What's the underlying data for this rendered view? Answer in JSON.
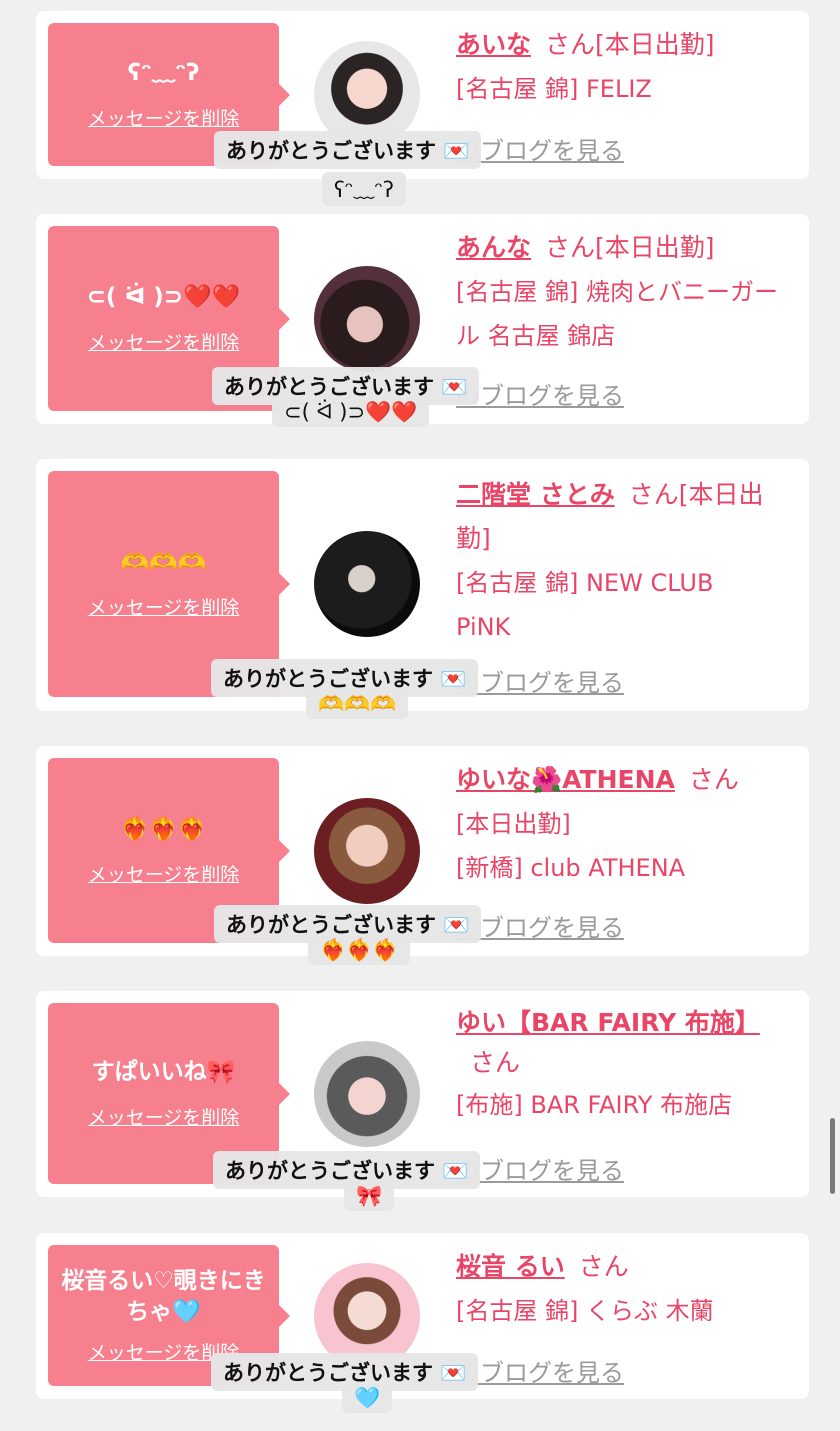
{
  "labels": {
    "delete": "メッセージを削除",
    "blog": "のブログを見る",
    "toast_title": "ありがとうございます",
    "mail_icon": "💌"
  },
  "cards": [
    {
      "message": "ʕᵔ﹏ᵔʔ",
      "name": "あいな",
      "san": "さん[本日出勤]",
      "shop": "[名古屋 錦] FELIZ",
      "toast_sub": "ʕᵔ﹏ᵔʔ"
    },
    {
      "message": "⊂( ᐛ )⊃❤️❤️",
      "name": "あんな",
      "san": "さん[本日出勤]",
      "shop": "[名古屋 錦] 焼肉とバニーガール 名古屋 錦店",
      "toast_sub": "⊂( ᐛ )⊃❤️❤️"
    },
    {
      "message": "🫶🫶🫶",
      "name": "二階堂 さとみ",
      "san": "さん[本日出勤]",
      "shop": "[名古屋 錦] NEW CLUB PiNK",
      "toast_sub": "🫶🫶🫶"
    },
    {
      "message": "❤️‍🔥❤️‍🔥❤️‍🔥",
      "name": "ゆいな🌺ATHENA",
      "san": "さん",
      "status": "[本日出勤]",
      "shop": "[新橋] club ATHENA",
      "toast_sub": "❤️‍🔥❤️‍🔥❤️‍🔥"
    },
    {
      "message": "すぱいいね🎀",
      "name": "ゆい【BAR FAIRY 布施】",
      "san": "さん",
      "shop": "[布施] BAR FAIRY 布施店",
      "toast_sub": "🎀"
    },
    {
      "message": "桜音るい♡覗きにきちゃ🩵",
      "name": "桜音 るい",
      "san": "さん",
      "shop": "[名古屋 錦] くらぶ 木蘭",
      "toast_sub": "🩵"
    }
  ],
  "colors": {
    "accent": "#e94667",
    "bubble": "#f7808f"
  }
}
